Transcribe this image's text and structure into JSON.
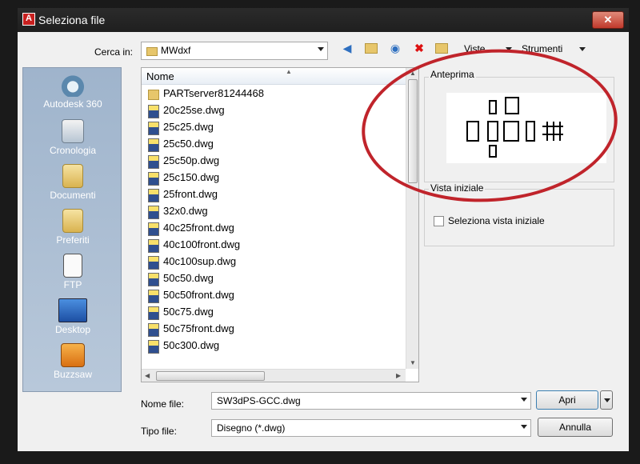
{
  "window": {
    "title": "Seleziona file",
    "close_glyph": "✕",
    "logo_letter": "A"
  },
  "toolbar": {
    "look_in_label": "Cerca in:",
    "look_in_value": "MWdxf",
    "views_label": "Viste",
    "tools_label": "Strumenti",
    "icons": [
      "back-arrow-icon",
      "up-folder-icon",
      "search-web-icon",
      "delete-icon",
      "new-folder-icon"
    ]
  },
  "places": [
    {
      "label": "Autodesk 360",
      "icon": "autodesk-360-icon"
    },
    {
      "label": "Cronologia",
      "icon": "history-icon"
    },
    {
      "label": "Documenti",
      "icon": "documents-folder-icon"
    },
    {
      "label": "Preferiti",
      "icon": "favorites-folder-icon"
    },
    {
      "label": "FTP",
      "icon": "ftp-icon"
    },
    {
      "label": "Desktop",
      "icon": "desktop-icon"
    },
    {
      "label": "Buzzsaw",
      "icon": "buzzsaw-icon"
    }
  ],
  "file_list": {
    "column_header": "Nome",
    "items": [
      {
        "name": "PARTserver81244468",
        "type": "folder"
      },
      {
        "name": "20c25se.dwg",
        "type": "dwg"
      },
      {
        "name": "25c25.dwg",
        "type": "dwg"
      },
      {
        "name": "25c50.dwg",
        "type": "dwg"
      },
      {
        "name": "25c50p.dwg",
        "type": "dwg"
      },
      {
        "name": "25c150.dwg",
        "type": "dwg"
      },
      {
        "name": "25front.dwg",
        "type": "dwg"
      },
      {
        "name": "32x0.dwg",
        "type": "dwg"
      },
      {
        "name": "40c25front.dwg",
        "type": "dwg"
      },
      {
        "name": "40c100front.dwg",
        "type": "dwg"
      },
      {
        "name": "40c100sup.dwg",
        "type": "dwg"
      },
      {
        "name": "50c50.dwg",
        "type": "dwg"
      },
      {
        "name": "50c50front.dwg",
        "type": "dwg"
      },
      {
        "name": "50c75.dwg",
        "type": "dwg"
      },
      {
        "name": "50c75front.dwg",
        "type": "dwg"
      },
      {
        "name": "50c300.dwg",
        "type": "dwg"
      }
    ]
  },
  "preview": {
    "label": "Anteprima"
  },
  "initial_view": {
    "label": "Vista iniziale",
    "checkbox_label": "Seleziona vista iniziale",
    "checked": false
  },
  "footer": {
    "filename_label": "Nome file:",
    "filename_value": "SW3dPS-GCC.dwg",
    "filetype_label": "Tipo file:",
    "filetype_value": "Disegno (*.dwg)",
    "open_button": "Apri",
    "cancel_button": "Annulla"
  },
  "colors": {
    "annotation_ellipse": "#c0242b",
    "places_bar": "#a9bcd2",
    "close_button": "#c0392b"
  }
}
